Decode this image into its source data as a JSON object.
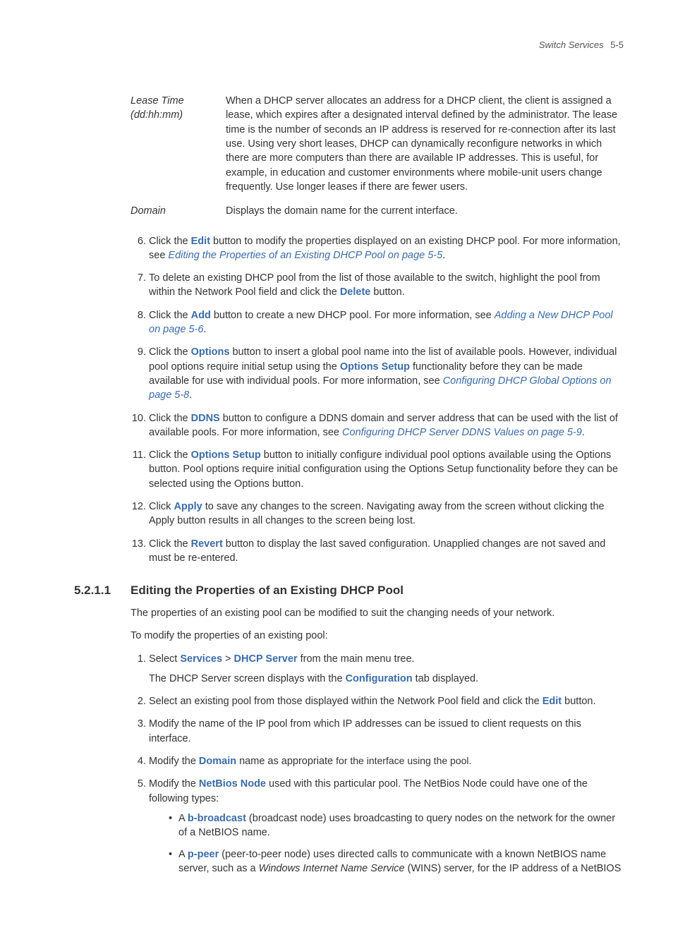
{
  "header": {
    "title": "Switch Services",
    "page": "5-5"
  },
  "defs": {
    "leaseTime": {
      "label": "Lease Time (dd:hh:mm)",
      "desc": "When a DHCP server allocates an address for a DHCP client, the client is assigned a lease, which expires after a designated interval defined by the administrator. The lease time is the number of seconds an IP address is reserved for re-connection after its last use. Using very short leases, DHCP can dynamically reconfigure networks in which there are more computers than there are available IP addresses. This is useful, for example, in education and customer environments where mobile-unit users change frequently. Use longer leases if there are fewer users."
    },
    "domain": {
      "label": "Domain",
      "desc": "Displays the domain name for the current interface."
    }
  },
  "steps": {
    "s6": {
      "n": "6.",
      "a": "Click the ",
      "b": "Edit",
      "c": " button to modify the properties displayed on an existing DHCP pool. For more information, see ",
      "link": "Editing the Properties of an Existing DHCP Pool on page 5-5",
      "d": "."
    },
    "s7": {
      "n": "7.",
      "a": "To delete an existing DHCP pool from the list of those available to the switch, highlight the pool from within the Network Pool field and click the ",
      "b": "Delete",
      "c": " button."
    },
    "s8": {
      "n": "8.",
      "a": "Click the ",
      "b": "Add",
      "c": " button to create a new DHCP pool. For more information, see ",
      "link": "Adding a New DHCP Pool on page 5-6",
      "d": "."
    },
    "s9": {
      "n": "9.",
      "a": "Click the ",
      "b": "Options",
      "c": " button to insert a global pool name into the list of available pools. However, individual pool options require initial setup using the ",
      "b2": "Options Setup",
      "c2": " functionality before they can be made available for use with individual pools. For more information, see ",
      "link": "Configuring DHCP Global Options on page 5-8",
      "d": "."
    },
    "s10": {
      "n": "10.",
      "a": "Click the ",
      "b": "DDNS",
      "c": " button to configure a DDNS domain and server address that can be used with the list of available pools. For more information, see ",
      "link": "Configuring DHCP Server DDNS Values on page 5-9",
      "d": "."
    },
    "s11": {
      "n": "11.",
      "a": "Click the ",
      "b": "Options Setup",
      "c": " button to initially configure individual pool options available using the Options button. Pool options require initial configuration using the Options Setup functionality before they can be selected using the Options button."
    },
    "s12": {
      "n": "12.",
      "a": "Click ",
      "b": "Apply",
      "c": " to save any changes to the screen. Navigating away from the screen without clicking the Apply button results in all changes to the screen being lost."
    },
    "s13": {
      "n": "13.",
      "a": "Click the ",
      "b": "Revert",
      "c": " button to display the last saved configuration. Unapplied changes are not saved and must be re-entered."
    }
  },
  "section": {
    "num": "5.2.1.1",
    "title": "Editing the Properties of an Existing DHCP Pool",
    "p1": "The properties of an existing pool can be modified to suit the changing needs of your network.",
    "p2": "To modify the properties of an existing pool:",
    "steps": {
      "e1": {
        "n": "1.",
        "a": "Select ",
        "b": "Services",
        "sep": " > ",
        "b2": "DHCP Server",
        "c": " from the main menu tree.",
        "sub_a": "The DHCP Server screen displays with the ",
        "sub_b": "Configuration",
        "sub_c": " tab displayed."
      },
      "e2": {
        "n": "2.",
        "a": "Select an existing pool from those displayed within the Network Pool field and click the ",
        "b": "Edit",
        "c": " button."
      },
      "e3": {
        "n": "3.",
        "a": "Modify the name of the IP pool from which IP addresses can be issued to client requests on this interface."
      },
      "e4": {
        "n": "4.",
        "a": "Modify the ",
        "b": "Domain",
        "c": " name as appropriate ",
        "tail": "for the interface using the pool."
      },
      "e5": {
        "n": "5.",
        "a": "Modify the ",
        "b": "NetBios Node",
        "c": " used with this particular pool. The NetBios Node could have one of the following types:"
      }
    },
    "bullets": {
      "b1": {
        "a": "A ",
        "b": "b-broadcast",
        "c": " (broadcast node) uses broadcasting to query nodes on the network for the owner of a NetBIOS name."
      },
      "b2": {
        "a": "A ",
        "b": "p-peer",
        "c": " (peer-to-peer node) uses directed calls to communicate with a known NetBIOS name server, such as a ",
        "i": "Windows Internet Name Service",
        "d": " (WINS) server, for the IP address of a NetBIOS"
      }
    }
  }
}
